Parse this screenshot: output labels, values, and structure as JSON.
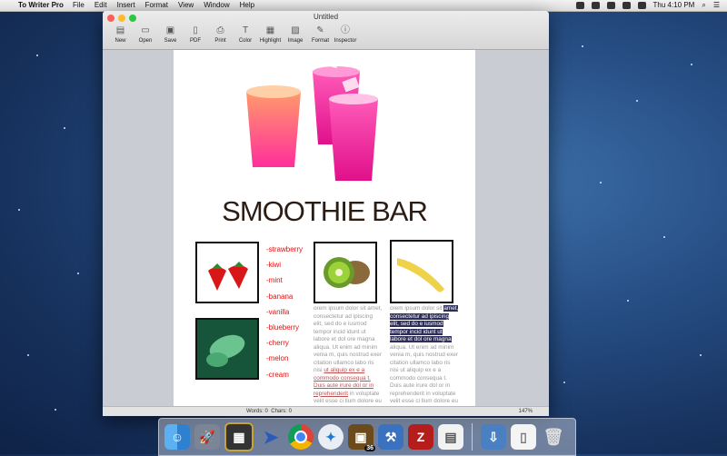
{
  "menubar": {
    "app_name": "To Writer Pro",
    "items": [
      "File",
      "Edit",
      "Insert",
      "Format",
      "View",
      "Window",
      "Help"
    ],
    "clock": "Thu 4:10 PM"
  },
  "window": {
    "title": "Untitled",
    "toolbar": [
      {
        "label": "New",
        "icon": "new-doc-icon"
      },
      {
        "label": "Open",
        "icon": "folder-icon"
      },
      {
        "label": "Save",
        "icon": "save-icon"
      },
      {
        "label": "PDF",
        "icon": "pdf-icon"
      },
      {
        "label": "Print",
        "icon": "print-icon"
      },
      {
        "label": "Color",
        "icon": "text-color-icon"
      },
      {
        "label": "Highlight",
        "icon": "highlight-icon"
      },
      {
        "label": "Image",
        "icon": "image-icon"
      },
      {
        "label": "Format",
        "icon": "format-icon"
      },
      {
        "label": "Inspector",
        "icon": "info-icon"
      }
    ],
    "status": {
      "words": "Words: 0",
      "chars": "Chars: 0",
      "zoom": "147%"
    }
  },
  "document": {
    "heading": "SMOOTHIE BAR",
    "flavors": [
      "-strawberry",
      "-kiwi",
      "-mint",
      "-banana",
      "-vanilla",
      "-blueberry",
      "-cherry",
      "-melon",
      "-cream"
    ],
    "lorem_col1": {
      "plain_before": "orem ipsum dolor sit amet, consectetur ad ipiscing elit, sed do e iusmod tempor incid idunt ut labore et dol ore magna aliqua. Ut enim ad minim venia m, quis nostrud exer citation ullamco labo ris nisi ",
      "underlined": "ut aliquip ex e a commodo consequa t. Duis aute irure dol or in reprehenderit",
      "plain_after": " in voluptate velit esse ci llum dolore eu fugiat nulla pariatur."
    },
    "lorem_col2": {
      "plain_start": "orem ipsum dolor sit ",
      "highlighted": "amet, consectetur ad ipiscing elit, sed do e iusmod tempor incid idunt ut labore et dol ore magna",
      "plain_after": " aliqua. Ut enim ad minim venia m, quis nostrud exer citation ullamco labo ris nisi ut aliquip ex e a commodo consequa t. Duis aute irure dol or in reprehenderit in voluptate velit esse ci llum dolore eu fugiat nulla pariatur."
    }
  },
  "dock": {
    "apps": [
      "finder-icon",
      "launchpad-icon",
      "mission-control-icon",
      "to-writer-icon",
      "chrome-icon",
      "safari-icon",
      "box-app-icon",
      "xcode-icon",
      "filezilla-icon",
      "document-icon",
      "downloads-icon",
      "file-icon",
      "trash-icon"
    ],
    "badge": "36"
  },
  "colors": {
    "accent_red": "#e01010",
    "highlight": "#2e2e5a"
  }
}
